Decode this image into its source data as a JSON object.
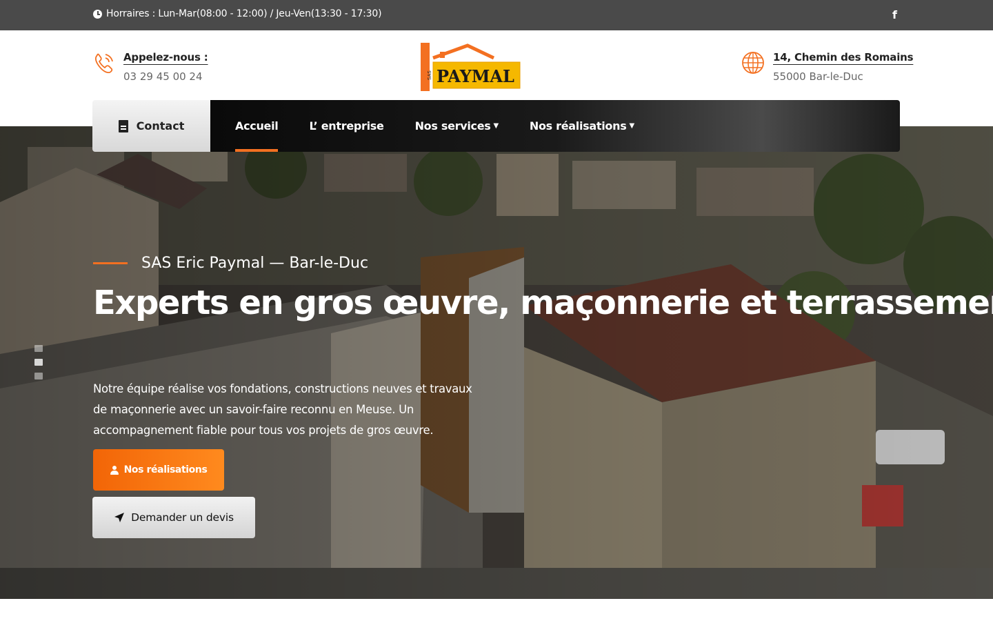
{
  "topbar": {
    "hours": "Horraires : Lun-Mar(08:00 - 12:00) / Jeu-Ven(13:30 - 17:30)",
    "social_icon": "facebook-icon"
  },
  "header": {
    "call_label": "Appelez-nous :",
    "call_value": "03 29 45 00 24",
    "call_icon": "phone-icon",
    "address_label": "14, Chemin des Romains",
    "address_value": "55000 Bar-le-Duc",
    "address_icon": "globe-icon",
    "logo": {
      "name": "PAYMAL",
      "prefix": "SAS"
    }
  },
  "nav": {
    "contact": "Contact",
    "items": [
      {
        "label": "Accueil",
        "active": true,
        "dropdown": false
      },
      {
        "label": "L’ entreprise",
        "active": false,
        "dropdown": false
      },
      {
        "label": "Nos services",
        "active": false,
        "dropdown": true
      },
      {
        "label": "Nos réalisations",
        "active": false,
        "dropdown": true
      }
    ]
  },
  "hero": {
    "subtitle": "SAS Eric Paymal — Bar-le-Duc",
    "headline": "Experts en gros œuvre, maçonnerie et terrassement",
    "description": "Notre équipe réalise vos fondations, constructions neuves et travaux de maçonnerie avec un savoir-faire reconnu en Meuse. Un accompagnement fiable pour tous vos projets de gros œuvre.",
    "primary_button": "Nos réalisations",
    "secondary_button": "Demander un devis"
  },
  "colors": {
    "accent": "#f37021",
    "topbar": "#4a4a4a",
    "logo_yellow": "#f5b800"
  }
}
